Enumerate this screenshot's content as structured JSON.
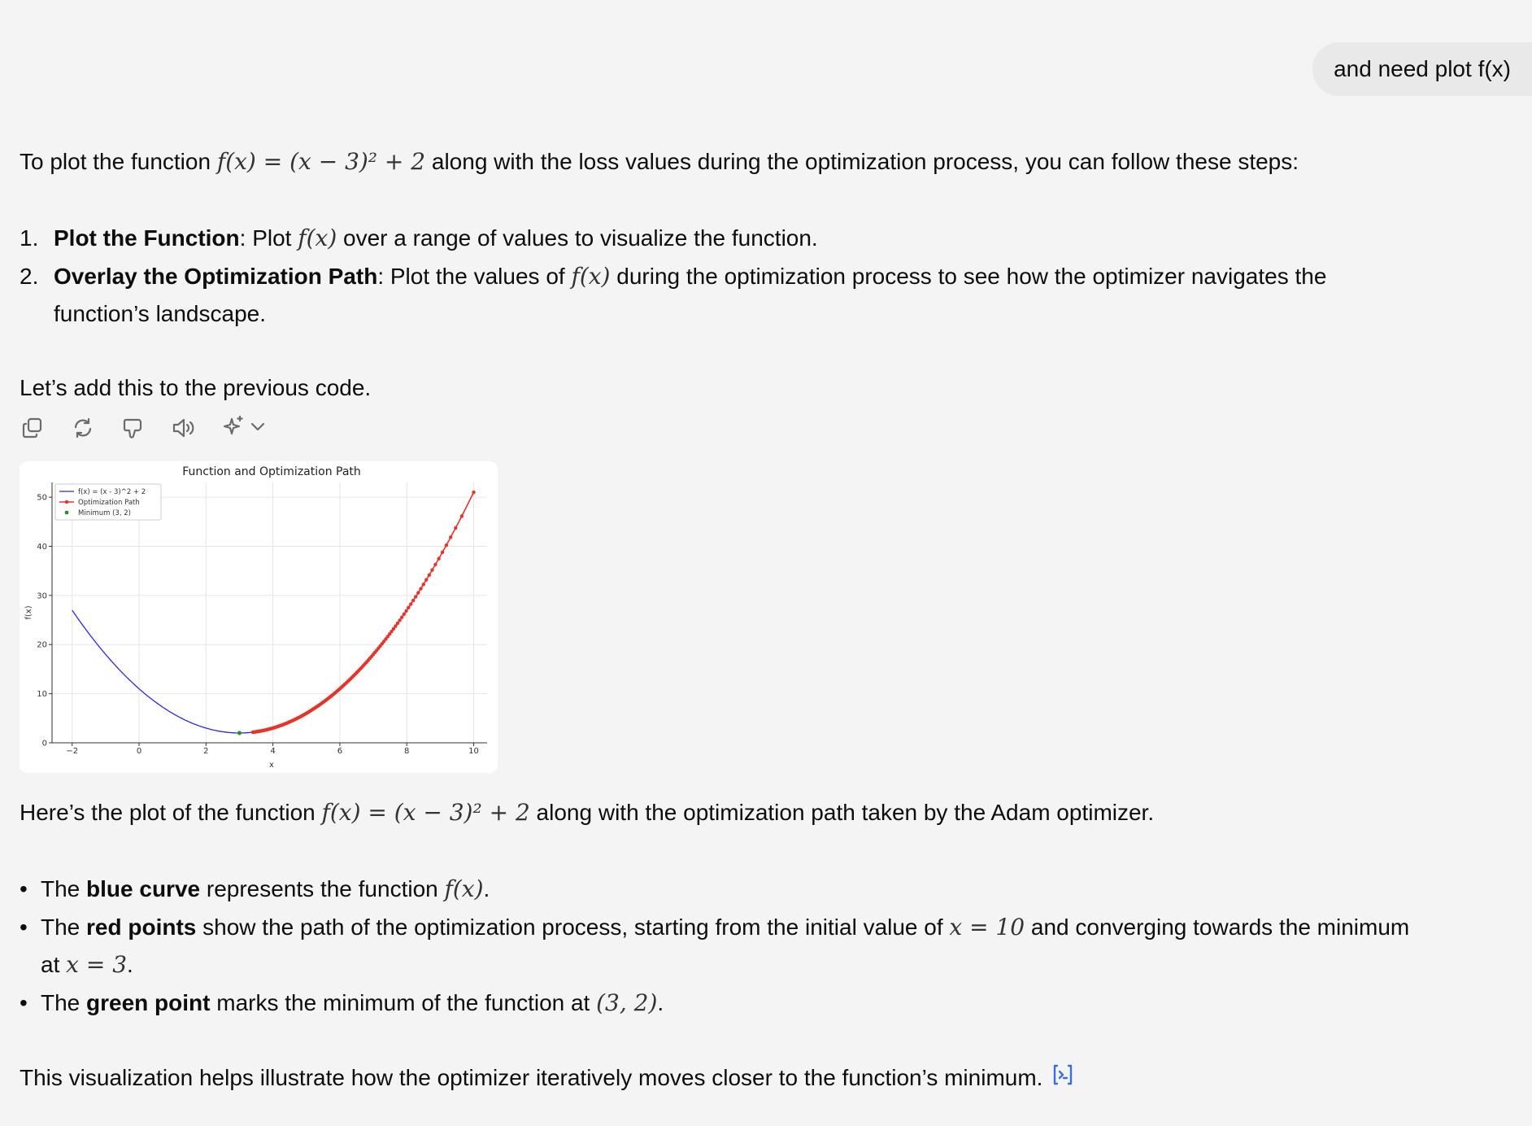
{
  "user_message": "and need plot f(x)",
  "intro": {
    "before": "To plot the function ",
    "math": "f(x) = (x − 3)² + 2",
    "after": " along with the loss values during the optimization process, you can follow these steps:"
  },
  "steps": [
    {
      "number": "1.",
      "title": "Plot the Function",
      "pre": ": Plot ",
      "math": "f(x)",
      "post": " over a range of values to visualize the function."
    },
    {
      "number": "2.",
      "title": "Overlay the Optimization Path",
      "pre": ": Plot the values of ",
      "math": "f(x)",
      "post": " during the optimization process to see how the optimizer navigates the",
      "continuation": "function’s landscape."
    }
  ],
  "lead_in": "Let’s add this to the previous code.",
  "toolbar": {
    "icons": [
      "copy-icon",
      "regenerate-icon",
      "thumbs-down-icon",
      "read-aloud-icon",
      "sparkle-icon",
      "chevron-down-icon"
    ]
  },
  "summary": {
    "before": "Here’s the plot of the function ",
    "math": "f(x) = (x − 3)² + 2",
    "after": " along with the optimization path taken by the Adam optimizer."
  },
  "bullets": [
    {
      "pre": "The ",
      "bold": "blue curve",
      "mid": " represents the function ",
      "math": "f(x)",
      "post": "."
    },
    {
      "pre": "The ",
      "bold": "red points",
      "mid": " show the path of the optimization process, starting from the initial value of ",
      "math": "x = 10",
      "post": " and converging towards the minimum",
      "continuation_pre": "at ",
      "continuation_math": "x = 3",
      "continuation_post": "."
    },
    {
      "pre": "The ",
      "bold": "green point",
      "mid": " marks the minimum of the function at ",
      "math": "(3, 2)",
      "post": "."
    }
  ],
  "closing": "This visualization helps illustrate how the optimizer iteratively moves closer to the function’s minimum.",
  "colors": {
    "function_curve": "#2a2ae6",
    "optimization_path": "#e8332a",
    "minimum_point": "#2e8b2e"
  },
  "chart_data": {
    "type": "line",
    "title": "Function and Optimization Path",
    "xlabel": "x",
    "ylabel": "f(x)",
    "xlim": [
      -2.6,
      10.4
    ],
    "ylim": [
      0,
      53
    ],
    "xticks": [
      -2,
      0,
      2,
      4,
      6,
      8,
      10
    ],
    "yticks": [
      0,
      10,
      20,
      30,
      40,
      50
    ],
    "grid": true,
    "legend_position": "top-left",
    "legend": [
      "f(x) = (x - 3)^2 + 2",
      "Optimization Path",
      "Minimum (3, 2)"
    ],
    "function": {
      "name": "f(x) = (x - 3)^2 + 2",
      "x_range": [
        -2,
        8.1
      ],
      "expression": "(x - 3)^2 + 2"
    },
    "optimization_path": {
      "name": "Optimization Path",
      "start_x": 10,
      "end_x": 3.4
    },
    "minimum": {
      "name": "Minimum (3, 2)",
      "x": 3,
      "y": 2
    }
  }
}
